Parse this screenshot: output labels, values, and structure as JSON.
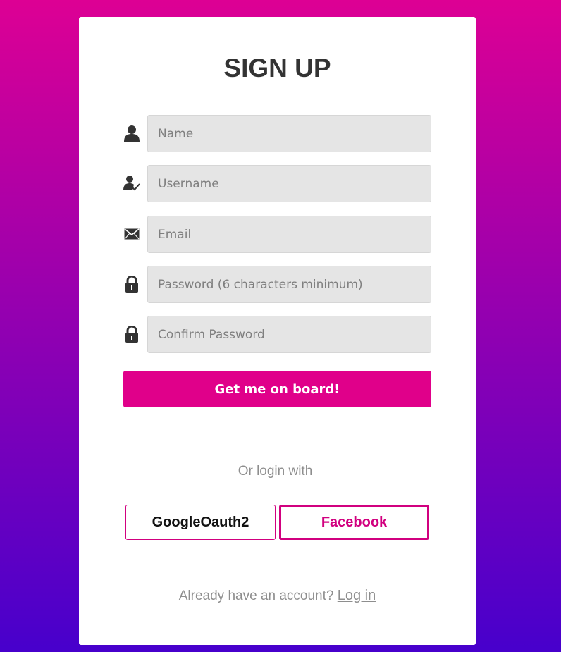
{
  "form": {
    "title": "SIGN UP",
    "fields": [
      {
        "icon": "user-icon",
        "placeholder": "Name"
      },
      {
        "icon": "user-check-icon",
        "placeholder": "Username"
      },
      {
        "icon": "envelope-icon",
        "placeholder": "Email"
      },
      {
        "icon": "lock-icon",
        "placeholder": "Password (6 characters minimum)"
      },
      {
        "icon": "lock-icon",
        "placeholder": "Confirm Password"
      }
    ],
    "submit_label": "Get me on board!"
  },
  "social": {
    "prompt": "Or login with",
    "google_label": "GoogleOauth2",
    "facebook_label": "Facebook"
  },
  "footer": {
    "text": "Already have an account?",
    "login_link": "Log in"
  },
  "colors": {
    "accent": "#e0008a",
    "gradient_top": "#dd0094",
    "gradient_bottom": "#4700cc"
  }
}
